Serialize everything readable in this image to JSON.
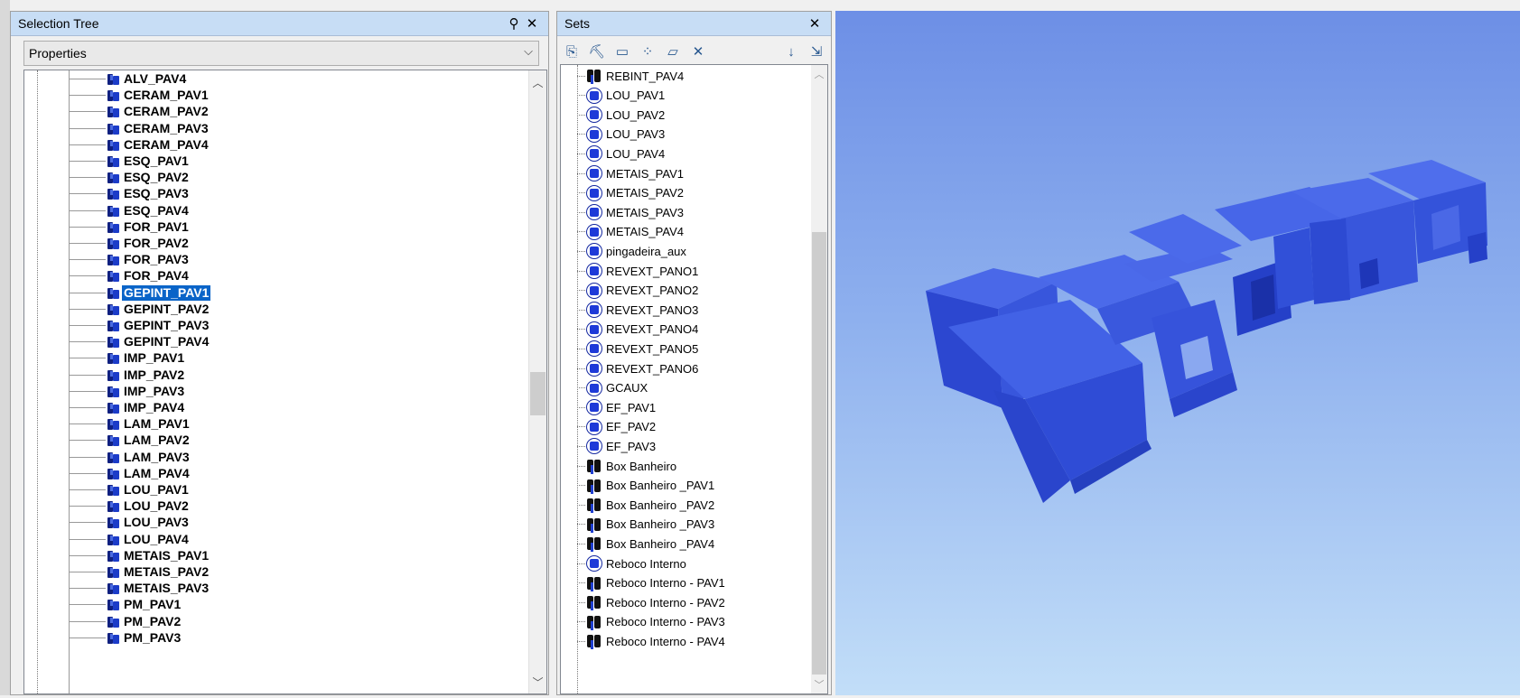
{
  "selection_tree": {
    "title": "Selection Tree",
    "dropdown_value": "Properties",
    "items": [
      "ALV_PAV4",
      "CERAM_PAV1",
      "CERAM_PAV2",
      "CERAM_PAV3",
      "CERAM_PAV4",
      "ESQ_PAV1",
      "ESQ_PAV2",
      "ESQ_PAV3",
      "ESQ_PAV4",
      "FOR_PAV1",
      "FOR_PAV2",
      "FOR_PAV3",
      "FOR_PAV4",
      "GEPINT_PAV1",
      "GEPINT_PAV2",
      "GEPINT_PAV3",
      "GEPINT_PAV4",
      "IMP_PAV1",
      "IMP_PAV2",
      "IMP_PAV3",
      "IMP_PAV4",
      "LAM_PAV1",
      "LAM_PAV2",
      "LAM_PAV3",
      "LAM_PAV4",
      "LOU_PAV1",
      "LOU_PAV2",
      "LOU_PAV3",
      "LOU_PAV4",
      "METAIS_PAV1",
      "METAIS_PAV2",
      "METAIS_PAV3",
      "PM_PAV1",
      "PM_PAV2",
      "PM_PAV3"
    ],
    "selected_item": "GEPINT_PAV1"
  },
  "sets": {
    "title": "Sets",
    "items": [
      {
        "label": "REBINT_PAV4",
        "icon": "binoculars-icon"
      },
      {
        "label": "LOU_PAV1",
        "icon": "selection-set-icon"
      },
      {
        "label": "LOU_PAV2",
        "icon": "selection-set-icon"
      },
      {
        "label": "LOU_PAV3",
        "icon": "selection-set-icon"
      },
      {
        "label": "LOU_PAV4",
        "icon": "selection-set-icon"
      },
      {
        "label": "METAIS_PAV1",
        "icon": "selection-set-icon"
      },
      {
        "label": "METAIS_PAV2",
        "icon": "selection-set-icon"
      },
      {
        "label": "METAIS_PAV3",
        "icon": "selection-set-icon"
      },
      {
        "label": "METAIS_PAV4",
        "icon": "selection-set-icon"
      },
      {
        "label": "pingadeira_aux",
        "icon": "selection-set-icon"
      },
      {
        "label": "REVEXT_PANO1",
        "icon": "selection-set-icon"
      },
      {
        "label": "REVEXT_PANO2",
        "icon": "selection-set-icon"
      },
      {
        "label": "REVEXT_PANO3",
        "icon": "selection-set-icon"
      },
      {
        "label": "REVEXT_PANO4",
        "icon": "selection-set-icon"
      },
      {
        "label": "REVEXT_PANO5",
        "icon": "selection-set-icon"
      },
      {
        "label": "REVEXT_PANO6",
        "icon": "selection-set-icon"
      },
      {
        "label": "GCAUX",
        "icon": "selection-set-icon"
      },
      {
        "label": "EF_PAV1",
        "icon": "selection-set-icon"
      },
      {
        "label": "EF_PAV2",
        "icon": "selection-set-icon"
      },
      {
        "label": "EF_PAV3",
        "icon": "selection-set-icon"
      },
      {
        "label": "Box Banheiro",
        "icon": "binoculars-icon"
      },
      {
        "label": "Box Banheiro _PAV1",
        "icon": "binoculars-icon"
      },
      {
        "label": "Box Banheiro _PAV2",
        "icon": "binoculars-icon"
      },
      {
        "label": "Box Banheiro _PAV3",
        "icon": "binoculars-icon"
      },
      {
        "label": "Box Banheiro _PAV4",
        "icon": "binoculars-icon"
      },
      {
        "label": "Reboco Interno",
        "icon": "selection-set-icon"
      },
      {
        "label": "Reboco Interno - PAV1",
        "icon": "binoculars-icon"
      },
      {
        "label": "Reboco Interno - PAV2",
        "icon": "binoculars-icon"
      },
      {
        "label": "Reboco Interno - PAV3",
        "icon": "binoculars-icon"
      },
      {
        "label": "Reboco Interno - PAV4",
        "icon": "binoculars-icon"
      }
    ],
    "toolbar": [
      "save-selection-icon",
      "save-search-icon",
      "new-folder-icon",
      "duplicate-icon",
      "add-comment-icon",
      "delete-icon",
      "sort-icon",
      "import-export-icon"
    ]
  },
  "colors": {
    "title_bar": "#c7ddf5",
    "selection_highlight": "#0a64c8",
    "model_blue": "#2a4ee8"
  }
}
